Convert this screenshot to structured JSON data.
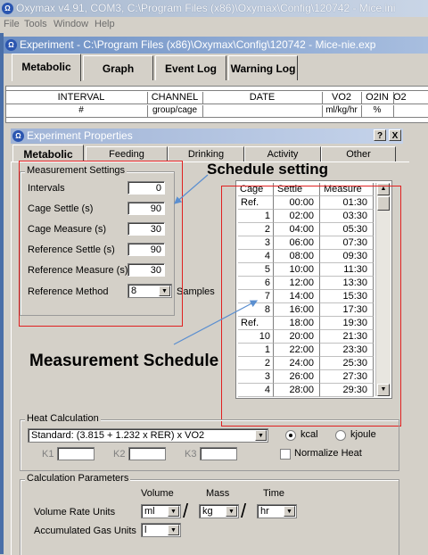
{
  "app": {
    "title": "Oxymax v4.91, COM3, C:\\Program Files (x86)\\Oxymax\\Config\\120742 - Mice.ini",
    "menu": [
      "File",
      "Tools",
      "Window",
      "Help"
    ]
  },
  "experiment_window": {
    "title": "Experiment - C:\\Program Files (x86)\\Oxymax\\Config\\120742 - Mice-nie.exp",
    "tabs": [
      "Metabolic",
      "Graph",
      "Event Log",
      "Warning Log"
    ],
    "table": {
      "headers": [
        "INTERVAL",
        "CHANNEL",
        "DATE",
        "VO2",
        "O2IN",
        "O2"
      ],
      "units": [
        "#",
        "group/cage",
        "",
        "ml/kg/hr",
        "%",
        ""
      ]
    }
  },
  "dialog": {
    "title": "Experiment Properties",
    "help_label": "?",
    "close_label": "X",
    "tabs": [
      "Metabolic",
      "Feeding",
      "Drinking",
      "Activity",
      "Other"
    ],
    "measurement": {
      "group_label": "Measurement Settings",
      "intervals_label": "Intervals",
      "intervals": "0",
      "cage_settle_label": "Cage Settle (s)",
      "cage_settle": "90",
      "cage_measure_label": "Cage Measure (s)",
      "cage_measure": "30",
      "ref_settle_label": "Reference Settle (s)",
      "ref_settle": "90",
      "ref_measure_label": "Reference Measure (s)",
      "ref_measure": "30",
      "ref_method_label": "Reference Method",
      "ref_method": "8",
      "ref_method_unit": "Samples"
    },
    "schedule": {
      "headers": [
        "Cage",
        "Settle",
        "Measure"
      ],
      "rows": [
        [
          "Ref.",
          "00:00",
          "01:30"
        ],
        [
          "1",
          "02:00",
          "03:30"
        ],
        [
          "2",
          "04:00",
          "05:30"
        ],
        [
          "3",
          "06:00",
          "07:30"
        ],
        [
          "4",
          "08:00",
          "09:30"
        ],
        [
          "5",
          "10:00",
          "11:30"
        ],
        [
          "6",
          "12:00",
          "13:30"
        ],
        [
          "7",
          "14:00",
          "15:30"
        ],
        [
          "8",
          "16:00",
          "17:30"
        ],
        [
          "Ref.",
          "18:00",
          "19:30"
        ],
        [
          "10",
          "20:00",
          "21:30"
        ],
        [
          "1",
          "22:00",
          "23:30"
        ],
        [
          "2",
          "24:00",
          "25:30"
        ],
        [
          "3",
          "26:00",
          "27:30"
        ],
        [
          "4",
          "28:00",
          "29:30"
        ]
      ]
    },
    "heat": {
      "group_label": "Heat Calculation",
      "formula": "Standard: (3.815 + 1.232 x RER) x VO2",
      "kcal_label": "kcal",
      "kjoule_label": "kjoule",
      "k1_label": "K1",
      "k2_label": "K2",
      "k3_label": "K3",
      "normalize_label": "Normalize Heat"
    },
    "calc": {
      "group_label": "Calculation Parameters",
      "col_volume": "Volume",
      "col_mass": "Mass",
      "col_time": "Time",
      "volume_rate_label": "Volume Rate Units",
      "volume_unit": "ml",
      "mass_unit": "kg",
      "time_unit": "hr",
      "acc_gas_label": "Accumulated Gas Units",
      "acc_gas_unit": "l",
      "slash": "/"
    }
  },
  "annotations": {
    "schedule_setting": "Schedule setting",
    "measurement_schedule": "Measurement Schedule",
    "box_color": "#e02020",
    "arrow_color": "#5b8fd0"
  }
}
